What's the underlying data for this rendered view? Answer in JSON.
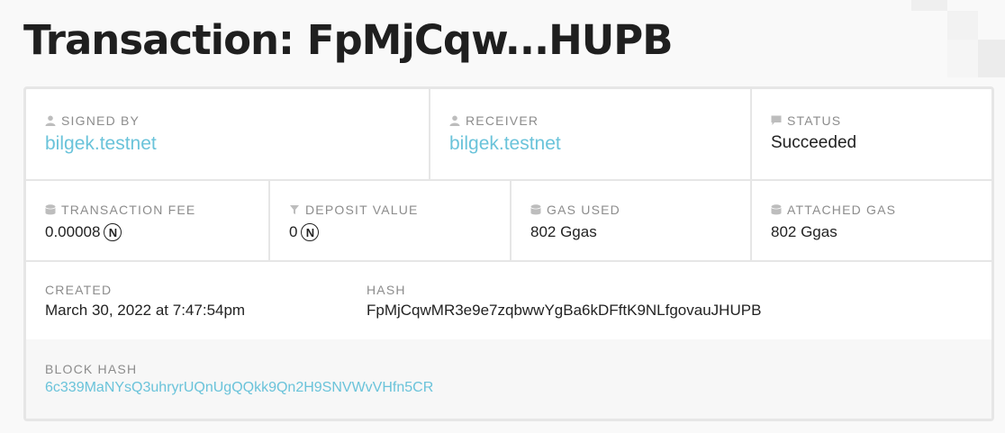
{
  "title": "Transaction: FpMjCqw...HUPB",
  "signed_by": {
    "label": "SIGNED BY",
    "value": "bilgek.testnet",
    "icon": "user-icon"
  },
  "receiver": {
    "label": "RECEIVER",
    "value": "bilgek.testnet",
    "icon": "user-icon"
  },
  "status": {
    "label": "STATUS",
    "value": "Succeeded",
    "icon": "comment-icon"
  },
  "transaction_fee": {
    "label": "TRANSACTION FEE",
    "value": "0.00008",
    "unit": "N",
    "icon": "database-icon"
  },
  "deposit_value": {
    "label": "DEPOSIT VALUE",
    "value": "0",
    "unit": "N",
    "icon": "funnel-icon"
  },
  "gas_used": {
    "label": "GAS USED",
    "value": "802 Ggas",
    "icon": "database-icon"
  },
  "attached_gas": {
    "label": "ATTACHED GAS",
    "value": "802 Ggas",
    "icon": "database-icon"
  },
  "created": {
    "label": "CREATED",
    "value": "March 30, 2022 at 7:47:54pm"
  },
  "hash": {
    "label": "HASH",
    "value": "FpMjCqwMR3e9e7zqbwwYgBa6kDFftK9NLfgovauJHUPB"
  },
  "block_hash": {
    "label": "BLOCK HASH",
    "value": "6c339MaNYsQ3uhryrUQnUgQQkk9Qn2H9SNVWvVHfn5CR"
  },
  "colors": {
    "link": "#6ac3da",
    "label": "#8c8c8c",
    "text": "#222222",
    "border": "#e6e6e6"
  }
}
